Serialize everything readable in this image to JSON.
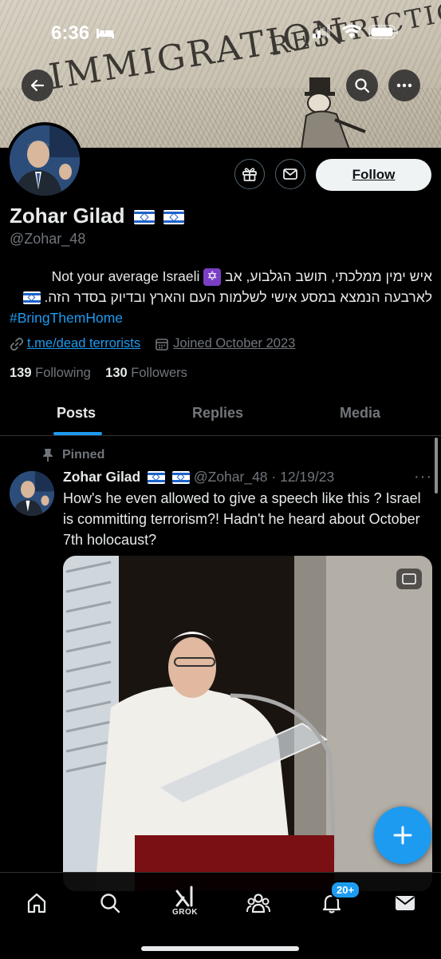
{
  "status_bar": {
    "time": "6:36"
  },
  "banner": {
    "text_line1": "IMMIGRATION",
    "text_line2": "RESTRICTION"
  },
  "profile": {
    "name": "Zohar Gilad",
    "handle": "@Zohar_48",
    "follow_label": "Follow",
    "bio_line1_hebrew": "איש ימין ממלכתי, תושב הגלבוע, אב",
    "bio_line1_english": "Not your average Israeli",
    "bio_line2_hebrew": "לארבעה הנמצא במסע אישי לשלמות העם והארץ ובדיוק בסדר הזה.",
    "hashtag": "#BringThemHome",
    "link": "t.me/dead terrorists",
    "joined": "Joined October 2023",
    "following_count": "139",
    "following_label": "Following",
    "followers_count": "130",
    "followers_label": "Followers"
  },
  "tabs": [
    {
      "label": "Posts",
      "active": true
    },
    {
      "label": "Replies",
      "active": false
    },
    {
      "label": "Media",
      "active": false
    }
  ],
  "post": {
    "pinned_label": "Pinned",
    "author": "Zohar Gilad",
    "handle_date": "@Zohar_48 · 12/19/23",
    "text": "How's he even allowed to give a speech like this ? Israel is committing terrorism?! Hadn't he heard about October 7th holocaust?"
  },
  "bottom_nav": {
    "grok_label": "GROK",
    "notifications_badge": "20+"
  },
  "colors": {
    "accent": "#1d9bf0",
    "background": "#000000",
    "muted": "#71767b"
  }
}
